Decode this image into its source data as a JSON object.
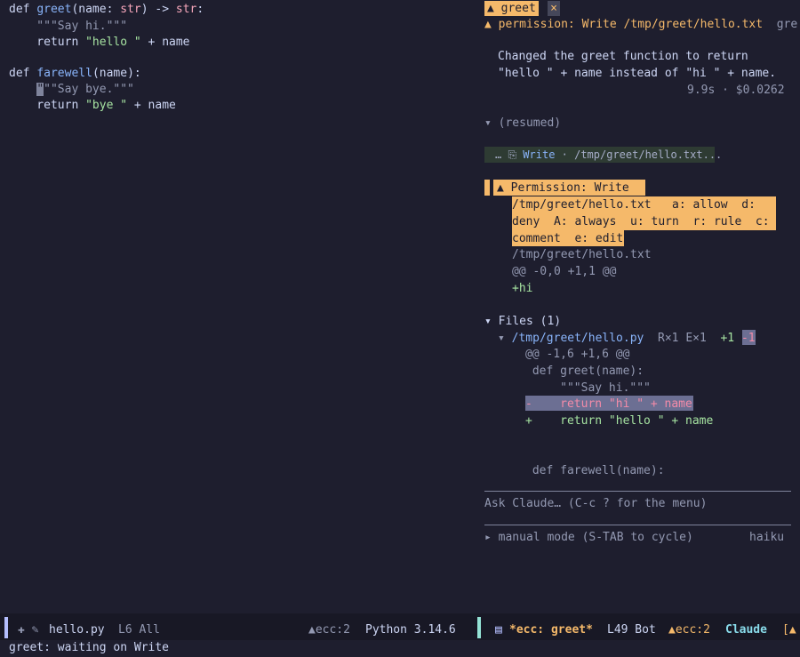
{
  "editor": {
    "lines": [
      {
        "kw": "def ",
        "fn": "greet",
        "a": "(name: ",
        "ty": "str",
        "b": ") -> ",
        "ty2": "str",
        ":": ":"
      },
      {
        "doc": "    \"\"\"Say hi.\"\"\""
      },
      {
        "kw": "    return ",
        "str": "\"hello \"",
        "rest": " + name"
      },
      {},
      {
        "kw": "def ",
        "fn": "farewell",
        "rest": "(name):"
      },
      {
        "cursor": "\"",
        "doc": "\"\"Say bye.\"\"\""
      },
      {
        "kw": "    return ",
        "str": "\"bye \"",
        "rest": " + name"
      }
    ]
  },
  "tabs": {
    "active_label": "▲ greet",
    "close": "×"
  },
  "claude": {
    "header_prefix": "▲ permission: ",
    "header_text": "Write /tmp/greet/hello.txt",
    "header_overflow": "gre",
    "summary_1": "Changed the greet function to return",
    "summary_2": "\"hello \" + name instead of \"hi \" + name.",
    "stats": "9.9s · $0.0262",
    "resumed": "▾ (resumed)",
    "write_chip": {
      "prefix": "… ",
      "icon": "⎘",
      "tool": "Write",
      "path": " · /tmp/greet/hello.txt..."
    },
    "permission": {
      "title": "▲ Permission: Write",
      "l2": "/tmp/greet/hello.txt   a: allow  d:",
      "l3": "deny  A: always  u: turn  r: rule  c:",
      "l4": "comment  e: edit",
      "file": "/tmp/greet/hello.txt",
      "hunk": "@@ -0,0 +1,1 @@",
      "added": "+hi"
    },
    "files": {
      "header": "▾ Files (1)",
      "entry_caret": "▾ ",
      "entry_path": "/tmp/greet/hello.py",
      "entry_meta": "  R×1 E×1  ",
      "plus": "+1",
      "minus": "-1",
      "hunk": "@@ -1,6 +1,6 @@",
      "ctx1": " def greet(name):",
      "ctx2": "     \"\"\"Say hi.\"\"\"",
      "del": "-    return \"hi \" + name",
      "add": "+    return \"hello \" + name",
      "ctx3": " def farewell(name):"
    },
    "input_placeholder": "Ask Claude… (C-c ? for the menu)",
    "mode": "▸ manual mode (S-TAB to cycle)",
    "model": "haiku"
  },
  "modeline": {
    "left_icons": "✚ ✎",
    "left_file": "hello.py",
    "left_pos": "L6 All",
    "left_ecc": "▲ecc:2",
    "left_lang": "Python 3.14.6",
    "right_icon": "▤",
    "right_buf": "*ecc: greet*",
    "right_pos": "L49 Bot",
    "right_ecc": "▲ecc:2",
    "right_mode": "Claude",
    "right_overflow": "[▲"
  },
  "echo": "greet: waiting on Write"
}
